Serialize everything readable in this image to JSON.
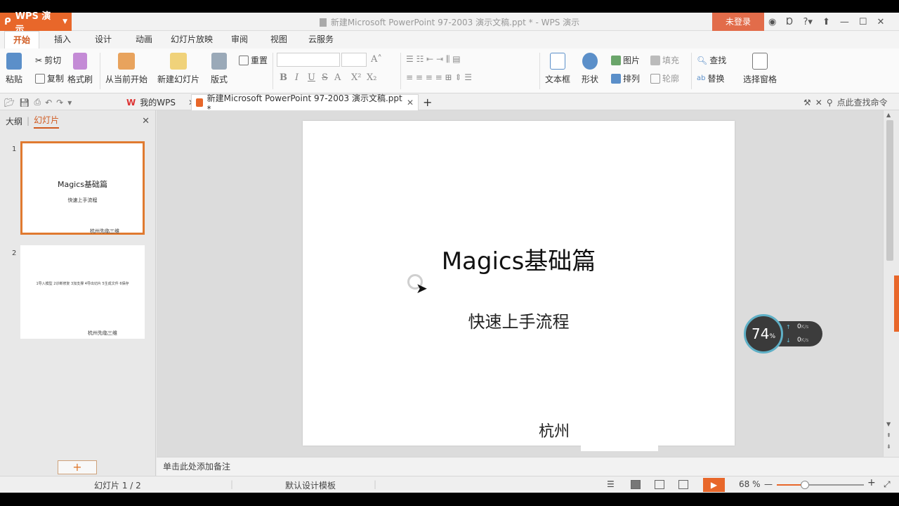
{
  "app": {
    "brand": "WPS 演示",
    "window_title": "新建Microsoft PowerPoint 97-2003 演示文稿.ppt * - WPS 演示",
    "login_label": "未登录"
  },
  "ribbon_tabs": [
    "开始",
    "插入",
    "设计",
    "动画",
    "幻灯片放映",
    "审阅",
    "视图",
    "云服务"
  ],
  "ribbon": {
    "paste": "粘贴",
    "cut": "剪切",
    "copy": "复制",
    "format_painter": "格式刷",
    "from_current": "从当前开始",
    "new_slide": "新建幻灯片",
    "layout": "版式",
    "reset": "重置",
    "text_box": "文本框",
    "shape": "形状",
    "picture": "图片",
    "fill": "填充",
    "arrange": "排列",
    "outline": "轮廓",
    "find": "查找",
    "replace": "替换",
    "selection_pane": "选择窗格"
  },
  "doc_tabs": {
    "my_wps": "我的WPS",
    "document": "新建Microsoft PowerPoint 97-2003 演示文稿.ppt *",
    "search_cmd": "点此查找命令"
  },
  "left_panel": {
    "tab_outline": "大纲",
    "tab_slides": "幻灯片",
    "slides": [
      {
        "num": "1",
        "title": "Magics基础篇",
        "subtitle": "快速上手流程",
        "footer": "杭州先临三维"
      },
      {
        "num": "2",
        "text": "1导入模型 2诊断修复 3加支撑 4导出切片 5生成文件 6保存",
        "footer": "杭州先临三维"
      }
    ]
  },
  "slide": {
    "title": "Magics基础篇",
    "subtitle": "快速上手流程",
    "footer": "杭州"
  },
  "net_widget": {
    "percent": "74",
    "unit": "%",
    "up_rate": "0",
    "down_rate": "0",
    "rate_unit": "K/s"
  },
  "notes_placeholder": "单击此处添加备注",
  "status": {
    "slide_counter": "幻灯片 1 / 2",
    "template": "默认设计模板",
    "zoom": "68 %",
    "zoom_level": 0.32
  },
  "colors": {
    "accent": "#e8672a",
    "login": "#e26c4a"
  }
}
